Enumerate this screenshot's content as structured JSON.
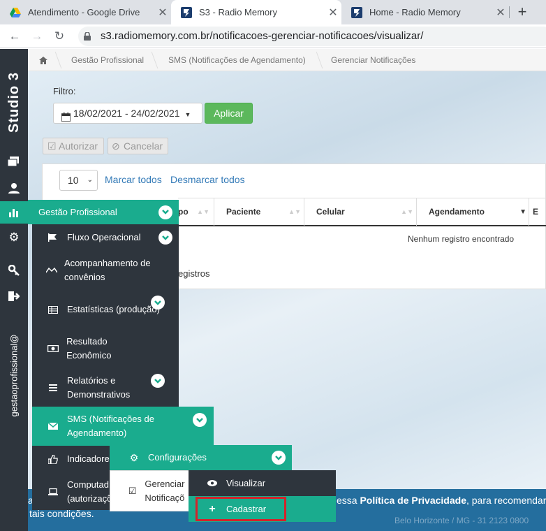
{
  "browser": {
    "tabs": [
      {
        "title": "Atendimento - Google Drive",
        "icon": "google-drive-icon"
      },
      {
        "title": "S3 - Radio Memory",
        "icon": "radio-memory-icon"
      },
      {
        "title": "Home - Radio Memory",
        "icon": "radio-memory-icon"
      }
    ],
    "new_tab": "+",
    "url": "s3.radiomemory.com.br/notificacoes-gerenciar-notificacoes/visualizar/"
  },
  "app": {
    "brand": "Studio 3",
    "user": "gestaoprofissional@"
  },
  "breadcrumb": [
    "Gestão Profissional",
    "SMS (Notificações de Agendamento)",
    "Gerenciar Notificações"
  ],
  "filter": {
    "label": "Filtro:",
    "date_range": "18/02/2021 - 24/02/2021",
    "apply": "Aplicar"
  },
  "actions": {
    "authorize": "Autorizar",
    "cancel": "Cancelar"
  },
  "table": {
    "page_size": "10",
    "mark_all": "Marcar todos",
    "unmark_all": "Desmarcar todos",
    "columns": [
      "po",
      "Paciente",
      "Celular",
      "Agendamento",
      "E"
    ],
    "empty": "Nenhum registro encontrado",
    "records": "egistros"
  },
  "footer": {
    "line1_pre": "a",
    "line1_mid": "essa ",
    "line1_bold": "Política de Privacidade",
    "line1_post": ", para recomendar co",
    "line2": "tais condições.",
    "address": "Belo Horizonte / MG - 31 2123 0800"
  },
  "menu": {
    "main": "Gestão Profissional",
    "items": [
      {
        "label": "Fluxo Operacional"
      },
      {
        "label": "Acompanhamento de convênios"
      },
      {
        "label": "Estatísticas (produção)"
      },
      {
        "label": "Resultado Econômico"
      },
      {
        "label": "Relatórios e Demonstrativos"
      },
      {
        "label": "SMS (Notificações de Agendamento)"
      },
      {
        "label": "Indicadores"
      },
      {
        "label": "Computad (autorizaçõ"
      }
    ],
    "sms_sub": {
      "label": "Configurações",
      "gerenciar": "Gerenciar Notificaçõ"
    },
    "gerenciar_sub": [
      {
        "label": "Visualizar"
      },
      {
        "label": "Cadastrar"
      }
    ]
  },
  "colors": {
    "accent": "#1aac8e",
    "sidebar": "#2e353d",
    "highlight": "#d4232a",
    "footer": "#246e9e"
  }
}
